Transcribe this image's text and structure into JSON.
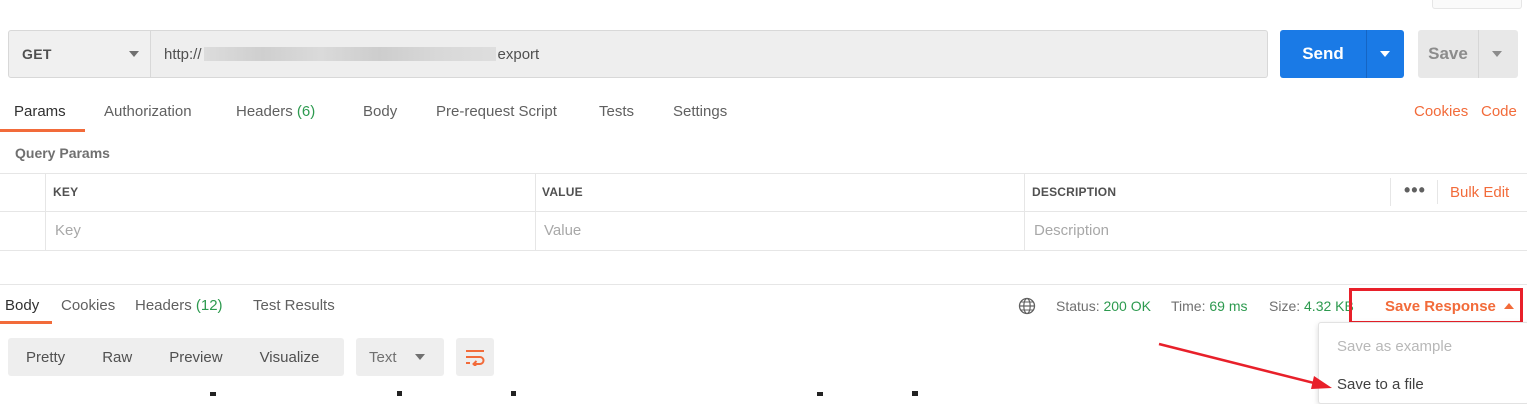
{
  "request": {
    "method": "GET",
    "url_start": "http://",
    "url_end": "export",
    "send_label": "Send",
    "save_label": "Save"
  },
  "request_tabs": [
    {
      "label": "Params",
      "active": true
    },
    {
      "label": "Authorization"
    },
    {
      "label": "Headers",
      "count": "(6)"
    },
    {
      "label": "Body"
    },
    {
      "label": "Pre-request Script"
    },
    {
      "label": "Tests"
    },
    {
      "label": "Settings"
    }
  ],
  "links": {
    "cookies": "Cookies",
    "code": "Code"
  },
  "params": {
    "section_title": "Query Params",
    "headers": {
      "key": "KEY",
      "value": "VALUE",
      "description": "DESCRIPTION"
    },
    "placeholders": {
      "key": "Key",
      "value": "Value",
      "description": "Description"
    },
    "more": "•••",
    "bulk_edit": "Bulk Edit"
  },
  "response_tabs": [
    {
      "label": "Body",
      "active": true
    },
    {
      "label": "Cookies"
    },
    {
      "label": "Headers",
      "count": "(12)"
    },
    {
      "label": "Test Results"
    }
  ],
  "response_meta": {
    "status_label": "Status:",
    "status_value": "200 OK",
    "time_label": "Time:",
    "time_value": "69 ms",
    "size_label": "Size:",
    "size_value": "4.32 KB"
  },
  "save_response": {
    "label": "Save Response",
    "menu": [
      {
        "label": "Save as example",
        "enabled": false
      },
      {
        "label": "Save to a file",
        "enabled": true
      }
    ]
  },
  "view_modes": [
    "Pretty",
    "Raw",
    "Preview",
    "Visualize"
  ],
  "format_select": "Text",
  "colors": {
    "accent": "#f26b3a",
    "primary_button": "#1a7ae6",
    "success": "#2d9a4f",
    "highlight_box": "#e8202a",
    "annotation_arrow": "#e8202a"
  },
  "icons": [
    "chevron-down-icon",
    "globe-icon",
    "wrap-lines-icon",
    "caret-up-icon",
    "more-dots-icon",
    "arrow-annotation"
  ]
}
